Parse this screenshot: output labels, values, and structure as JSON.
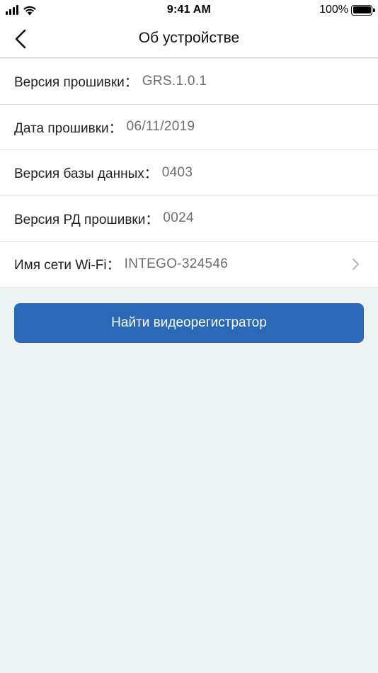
{
  "status_bar": {
    "time": "9:41 AM",
    "battery_percent": "100%",
    "icons": [
      "signal-icon",
      "wifi-icon",
      "battery-icon"
    ]
  },
  "nav": {
    "title": "Об устройстве",
    "back_icon": "chevron-left-icon"
  },
  "info": {
    "rows": [
      {
        "label": "Версия прошивки：",
        "value": "GRS.1.0.1"
      },
      {
        "label": "Дата прошивки：",
        "value": "06/11/2019"
      },
      {
        "label": "Версия базы данных：",
        "value": "0403"
      },
      {
        "label": "Версия РД прошивки：",
        "value": "0024"
      },
      {
        "label": "Имя сети Wi-Fi：",
        "value": "INTEGO-324546"
      }
    ]
  },
  "actions": {
    "find_button_label": "Найти видеорегистратор"
  },
  "colors": {
    "accent": "#2a69b8",
    "background": "#eef3f3",
    "value_text": "#6d6d6d"
  }
}
